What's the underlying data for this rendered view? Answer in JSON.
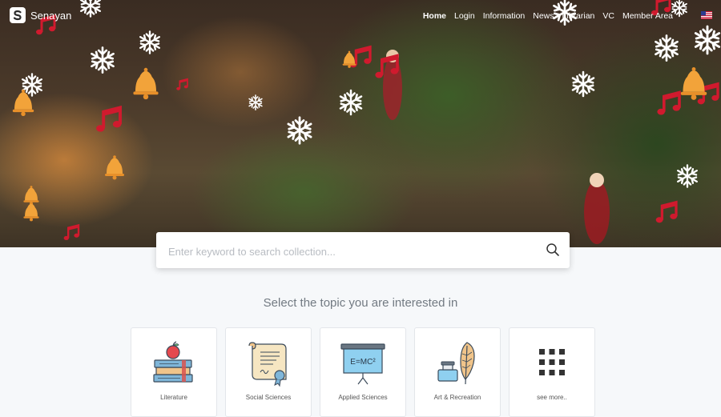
{
  "brand": {
    "name": "Senayan"
  },
  "nav": {
    "items": [
      "Home",
      "Login",
      "Information",
      "News",
      "Librarian",
      "VC",
      "Member Area"
    ],
    "active_index": 0
  },
  "search": {
    "placeholder": "Enter keyword to search collection..."
  },
  "topics_heading": "Select the topic you are interested in",
  "topics": [
    {
      "label": "Literature",
      "icon": "books-apple-icon"
    },
    {
      "label": "Social Sciences",
      "icon": "diploma-scroll-icon"
    },
    {
      "label": "Applied Sciences",
      "icon": "blackboard-emc2-icon"
    },
    {
      "label": "Art & Recreation",
      "icon": "ink-feather-icon"
    },
    {
      "label": "see more..",
      "icon": "grid-dots-icon"
    }
  ],
  "board_text": "E=MC²",
  "colors": {
    "accent": "#c8102e",
    "bell": "#f2a33a",
    "snow": "#ffffff"
  }
}
